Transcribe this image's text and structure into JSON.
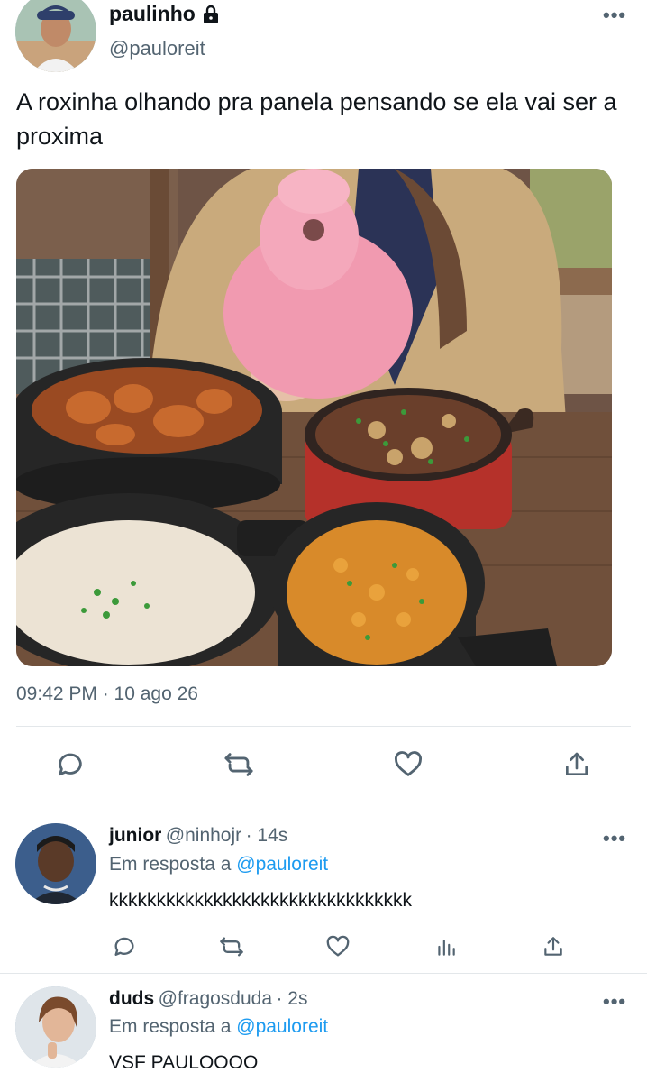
{
  "tweet": {
    "display_name": "paulinho",
    "handle": "@pauloreit",
    "text": "A roxinha olhando pra panela pensando se ela vai ser a proxima",
    "timestamp": "09:42 PM · 10 ago 26",
    "more_label": "•••"
  },
  "replies": [
    {
      "display_name": "junior",
      "handle": "@ninhojr",
      "time": "· 14s",
      "reply_prefix": "Em resposta a",
      "reply_mention": "@pauloreit",
      "text": "kkkkkkkkkkkkkkkkkkkkkkkkkkkkkkkk",
      "more_label": "•••"
    },
    {
      "display_name": "duds",
      "handle": "@fragosduda",
      "time": "· 2s",
      "reply_prefix": "Em resposta a",
      "reply_mention": "@pauloreit",
      "text": "VSF PAULOOOO",
      "more_label": "•••"
    }
  ],
  "icons": {
    "lock": "lock-icon",
    "reply": "reply-icon",
    "retweet": "retweet-icon",
    "like": "heart-icon",
    "share": "share-icon",
    "analytics": "analytics-icon"
  },
  "colors": {
    "text": "#0f1419",
    "secondary": "#536471",
    "link": "#1d9bf0",
    "divider": "#e3e7ea"
  }
}
